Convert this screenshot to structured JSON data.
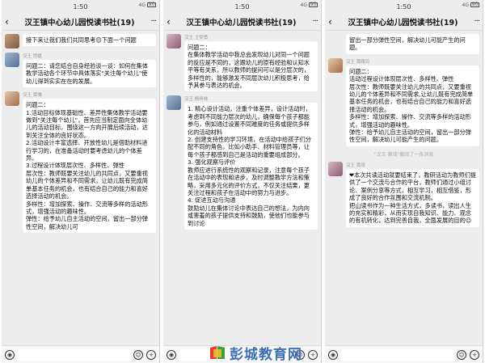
{
  "screens": [
    {
      "time": "1:50",
      "title": "汉王镇中心幼儿园悦读书社(19)",
      "messages": [
        {
          "sender": "",
          "text": "接下来让我们我们共同思考😊下面一个问题"
        },
        {
          "sender": "汉王 思媛",
          "text": "问题二：请您结合自身经验谈一谈：如何在集体教学活动各个环节中具体落实\"关注每个幼儿\"使幼儿得到实实在在的发展。"
        },
        {
          "sender": "汉王 黄雅",
          "text": "问题二：\n1.活动目标体现基础性、差异性集体教学活动要做到\"关注每个幼儿\"，首先应当制定面向全体幼儿的活动目标，围绕这一方向开展后续活动，达到关注全体的良好状态。\n2.活动设计丰富选择、开放性幼儿是借助材料进行学习的，在准备活动时要考虑幼儿的个体差异。\n3.过程设计体现层次性、多样性、弹性\n层次性：教师既要关注幼儿的共同点，又要重视幼儿的个体差异和不同需求，让幼儿既有完成简单基本任务的机会，也有结合自己的能力和喜好选择活动的机会。\n多样性：增加探索、操作、交流等多样的活动形式，增强活动的趣味性。\n弹性：给予幼儿自主活动的空间，留出一部分弹性空间，解决幼儿可"
        }
      ]
    },
    {
      "time": "1:50",
      "title": "汉王镇中心幼儿园悦读书社(19)",
      "messages": [
        {
          "sender": "汉王 王梦勇",
          "text": "问题二：\n在集体教学活动中我总会发现幼儿对同一个问题的反应是不同的，这跟幼儿的原有经验和认知水平等有关系，所以教师的提问可以是分层次的，多样性的，能够激发不同层次幼儿积极思考，给予其参与表达的机会。"
        },
        {
          "sender": "汉王 杨梓林",
          "text": "1. 精心设计活动，注重个体差异，设计活动时，考虑到不同能力层次的幼儿，确保每个孩子都能参与，例如通过设置不同难度的任务或提供多样化的活动材料\n2. 创建支持性的学习环境，在活动中给孩子们分配不同的角色，比如小助手、材料管理员等，让每个孩子都感到自己是活动的重要组成部分。\n3. 强化观察与评价\n教师应进行系统性的观察和记录，注意每个孩子在活动中的表现和进步，及时调整教学方法和策略，采用多元化的评价方式，不仅关注结果，更关注过程和孩子在活动中的努力与进步。\n4. 促进互动与沟通\n鼓励幼儿在集体讨论中表达自己的想法，为内向或害羞的孩子提供支持和鼓励，使他们也能参与到讨论"
        }
      ]
    },
    {
      "time": "1:50",
      "title": "汉王镇中心幼儿园悦读书社(19)",
      "messages": [
        {
          "sender": "",
          "text": "留出一部分弹性空间，解决幼儿可能产生的问题。"
        },
        {
          "sender": "汉王 黄路铃",
          "text": "问题二：\n活动过程设计体现层次性、多样性、弹性\n层次性：教师既要关注幼儿的共同点，又要重视幼儿的个体差异和不同需求,让幼儿既有完成简单基本任务的机会，也有结合自己的能力和喜好选择活动的机会。\n多样性：增加探索、操作、交流等多样的活动形式，增强活动的趣味性。\n弹性：给予幼儿自主活动的空间，留出一部分弹性空间，解决幼儿可能产生的问题。"
        },
        {
          "sender": "recall",
          "text": "\"汉王 黄琦\"撤回了一条消息"
        },
        {
          "sender": "汉王 黄琦",
          "text": "❤本次共读活动就要结束了，教研活动为教师们提供了一个交流与合作的平台，教师们通过小组讨论、案例分享等方式，相互学习，相互借鉴，形成了良好的合作氛围和交流机制。\n把山读书作为一种生活方式，多读书，读出人生的充实和精彩，从而实现自我知识、能力、观念的有机转化，达到完善自我，全面发展的目的😉"
        }
      ]
    }
  ],
  "status": {
    "signal": "4G",
    "battery": "90"
  },
  "watermark": {
    "text": "彭城教育网",
    "domain": "www"
  }
}
